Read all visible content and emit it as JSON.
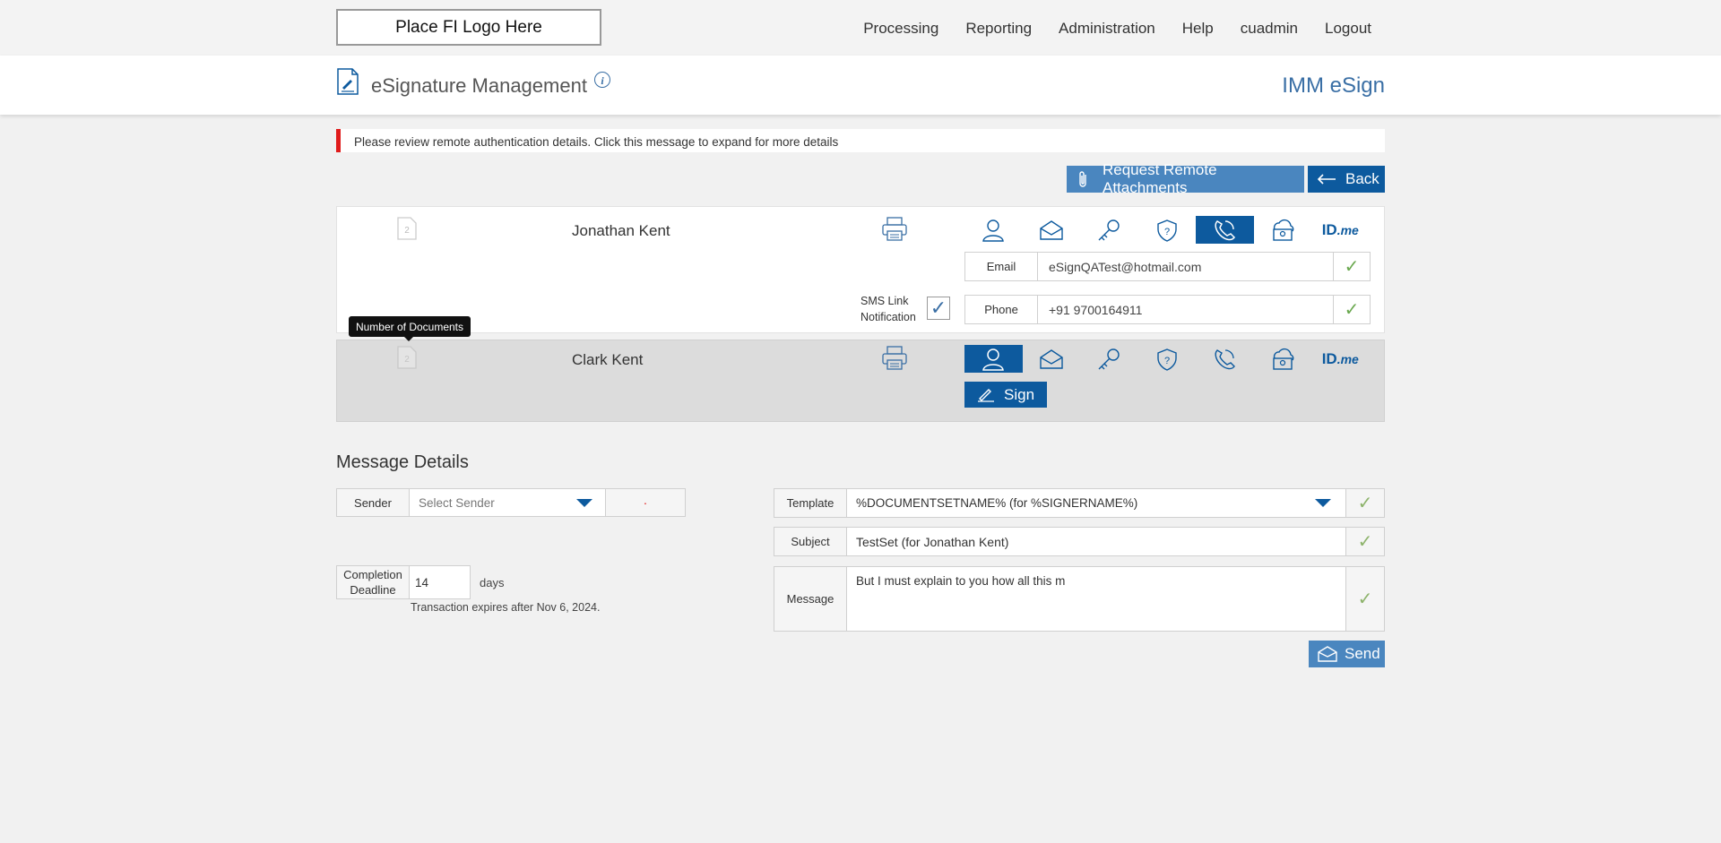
{
  "header": {
    "logo_text": "Place FI Logo Here",
    "nav": [
      "Processing",
      "Reporting",
      "Administration",
      "Help",
      "cuadmin",
      "Logout"
    ]
  },
  "page": {
    "title": "eSignature Management",
    "info_icon": "i",
    "brand": "IMM eSign"
  },
  "alert": {
    "text": "Please review remote authentication details. Click this message to expand for more details",
    "color": "#e01b1b"
  },
  "actions": {
    "request_attachments": "Request Remote Attachments",
    "back": "Back"
  },
  "signers": [
    {
      "doc_count": "2",
      "name": "Jonathan Kent",
      "active_auth": "phone-callback-icon",
      "email_label": "Email",
      "email_value": "eSignQATest@hotmail.com",
      "phone_label": "Phone",
      "phone_value": "+91 9700164911",
      "sms_label_1": "SMS Link",
      "sms_label_2": "Notification",
      "sms_checked": true
    },
    {
      "doc_count": "2",
      "name": "Clark Kent",
      "active_auth": "in-person-icon",
      "sign_label": "Sign"
    }
  ],
  "auth_icons": [
    "in-person-icon",
    "email-icon",
    "key-icon",
    "security-question-icon",
    "phone-callback-icon",
    "cloud-id-icon",
    "idme-icon"
  ],
  "idme": {
    "id": "ID",
    "me": ".me"
  },
  "tooltip": "Number of Documents",
  "message_details": {
    "title": "Message Details",
    "sender_label": "Sender",
    "sender_placeholder": "Select Sender",
    "sender_required_mark": "·",
    "completion_label_1": "Completion",
    "completion_label_2": "Deadline",
    "completion_value": "14",
    "days": "days",
    "expiry": "Transaction expires after Nov 6, 2024.",
    "template_label": "Template",
    "template_value": "%DOCUMENTSETNAME% (for %SIGNERNAME%)",
    "subject_label": "Subject",
    "subject_value": "TestSet (for Jonathan Kent)",
    "message_label": "Message",
    "message_value": "But I must explain to you how all this m",
    "send": "Send"
  },
  "colors": {
    "primary": "#0d5a9e",
    "secondary": "#4a86bf",
    "check_green": "#6aa84f"
  }
}
